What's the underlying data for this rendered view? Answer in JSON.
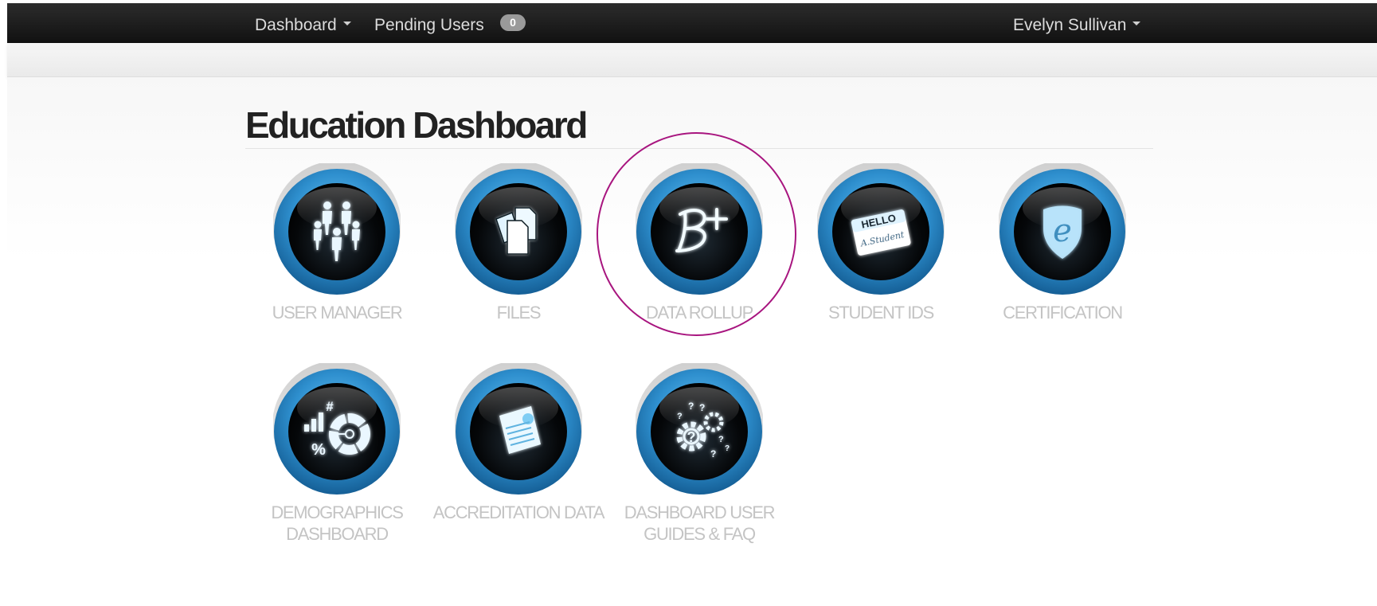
{
  "navbar": {
    "dashboard_label": "Dashboard",
    "pending_users_label": "Pending Users",
    "pending_users_count": "0",
    "user_name": "Evelyn Sullivan"
  },
  "page_title": "Education Dashboard",
  "tiles": [
    {
      "label": "USER MANAGER",
      "icon": "people-icon"
    },
    {
      "label": "FILES",
      "icon": "documents-icon"
    },
    {
      "label": "DATA ROLLUP",
      "icon": "grade-b-plus-icon",
      "highlighted": true
    },
    {
      "label": "STUDENT IDS",
      "icon": "hello-name-tag-icon",
      "tag_text_1": "HELLO",
      "tag_text_2": "A.Student"
    },
    {
      "label": "CERTIFICATION",
      "icon": "e-shield-icon",
      "shield_letter": "e"
    },
    {
      "label": "DEMOGRAPHICS DASHBOARD",
      "icon": "stats-chart-icon",
      "hash_symbol": "#",
      "percent_symbol": "%"
    },
    {
      "label": "ACCREDITATION DATA",
      "icon": "certificate-document-icon"
    },
    {
      "label": "DASHBOARD USER GUIDES & FAQ",
      "icon": "gears-question-icon"
    }
  ],
  "colors": {
    "navbar_bg": "#1a1a1a",
    "ring_blue": "#2e8fce",
    "label_gray": "#c4c4c4",
    "highlight_circle": "#a8157f"
  }
}
